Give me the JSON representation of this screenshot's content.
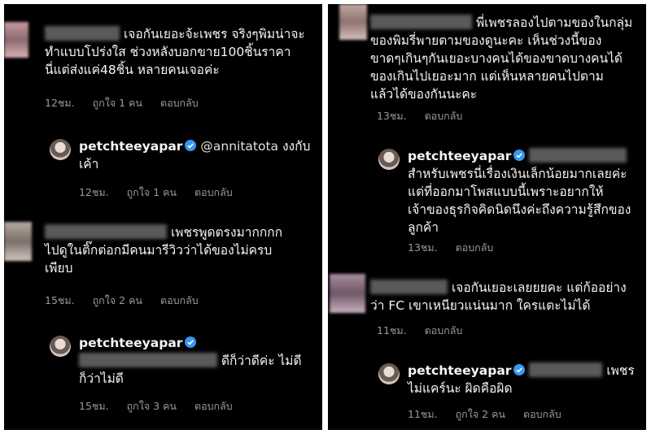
{
  "left": {
    "c1": {
      "text_line1": "เจอกันเยอะจ้ะเพชร จริงๆพิมน่าจะ",
      "text_line2": "ทำแบบโปร่งใส ช่วงหลังบอกขาย100ชิ้นราคา",
      "text_line3": "นี่แต่ส่งแค่48ชิ้น หลายคนเจอค่ะ",
      "time": "12ชม.",
      "likes": "ถูกใจ 1 คน",
      "reply": "ตอบกลับ"
    },
    "r1": {
      "user": "petchteeyapar",
      "mention": "@annitatota",
      "text_line1": "งงกับ",
      "text_line2": "เค้า",
      "time": "12ชม.",
      "likes": "ถูกใจ 1 คน",
      "reply": "ตอบกลับ"
    },
    "c2": {
      "text_line1": "เพชรพูดตรงมากกกก",
      "text_line2": "ไปดูในติ๊กต่อกมีคนมารีวิวว่าได้ของไม่ครบ",
      "text_line3": "เพียบ",
      "time": "15ชม.",
      "likes": "ถูกใจ 2 คน",
      "reply": "ตอบกลับ"
    },
    "r2": {
      "user": "petchteeyapar",
      "text_line1": "ดีก็ว่าดีค่ะ ไม่ดี",
      "text_line2": "ก็ว่าไม่ดี",
      "time": "15ชม.",
      "likes": "ถูกใจ 3 คน",
      "reply": "ตอบกลับ"
    }
  },
  "right": {
    "c1": {
      "text_line1": "พี่เพชรลองไปตามของในกลุ่ม",
      "text_line2": "ของพิมรี่พายตามของดูนะคะ เห็นช่วงนี้ของ",
      "text_line3": "ขาดๆเกินๆกันเยอะบางคนได้ของขาดบางคนได้",
      "text_line4": "ของเกินไปเยอะมาก แต่เห็นหลายคนไปตาม",
      "text_line5": "แล้วได้ของกันนะคะ",
      "time": "13ชม.",
      "reply": "ตอบกลับ"
    },
    "r1": {
      "user": "petchteeyapar",
      "text_line1": "สำหรับเพชรนี่เรื่องเงินเล็กน้อยมากเลยค่ะ",
      "text_line2": "แต่ที่ออกมาโพสแบบนี้เพราะอยากให้",
      "text_line3": "เจ้าของธุรกิจคิดนิดนึงค่ะถึงความรู้สึกของ",
      "text_line4": "ลูกค้า",
      "time": "13ชม.",
      "reply": "ตอบกลับ"
    },
    "c2": {
      "text_line1": "เจอกันเยอะเลยยยคะ แต่ก้ออย่าง",
      "text_line2": "ว่า FC เขาเหนียวแน่นมาก ใครแตะไม่ได้",
      "time": "11ชม.",
      "reply": "ตอบกลับ"
    },
    "r2": {
      "user": "petchteeyapar",
      "text_line1": "เพชร",
      "text_line2": "ไม่แคร์นะ ผิดคือผิด",
      "time": "11ชม.",
      "likes": "ถูกใจ 2 คน",
      "reply": "ตอบกลับ"
    }
  },
  "colors": {
    "background": "#000000",
    "text": "#f4f4f4",
    "meta": "#9a9a9a",
    "verified": "#3897f0"
  }
}
